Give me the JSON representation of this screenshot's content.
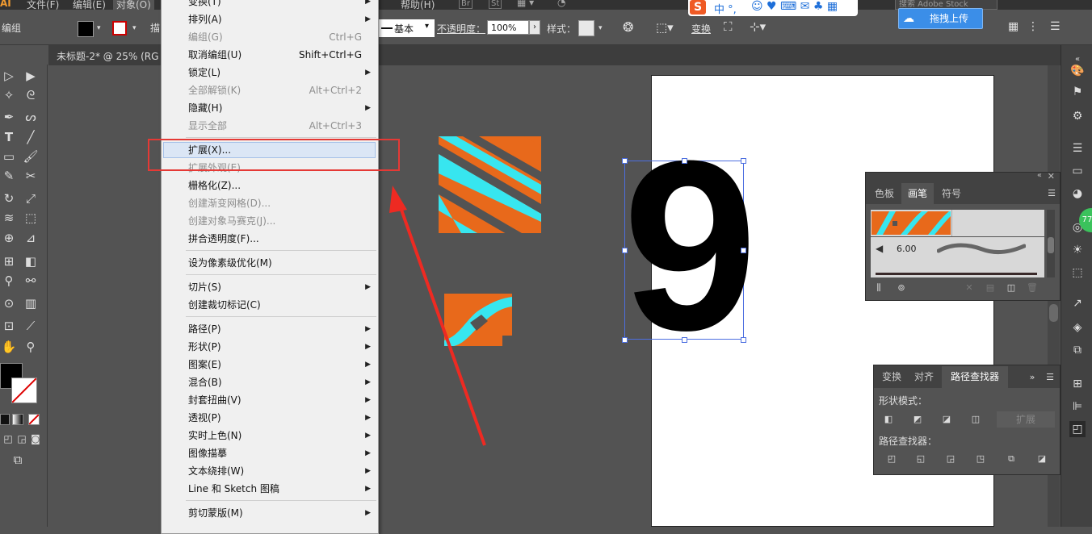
{
  "menubar": {
    "logo": "AI",
    "items": [
      "文件(F)",
      "编辑(E)",
      "对象(O)",
      "帮助(H)"
    ],
    "br": "Br",
    "st": "St",
    "search": "搜索 Adobe Stock"
  },
  "control": {
    "label_group": "编组",
    "stroke_style": "基本",
    "opacity_label": "不透明度：",
    "opacity_value": "100%",
    "style_label": "样式：",
    "transform": "变换",
    "truncated_char": "描"
  },
  "document": {
    "tab_title": "未标题-2* @ 25% (RG"
  },
  "sogou": {
    "chars": "中 °,",
    "upload_label": "拖拽上传"
  },
  "object_menu": {
    "items": [
      {
        "label": "变换(T)",
        "shortcut": "",
        "arrow": true,
        "disabled": false
      },
      {
        "label": "排列(A)",
        "shortcut": "",
        "arrow": true,
        "disabled": false
      },
      {
        "label": "编组(G)",
        "shortcut": "Ctrl+G",
        "arrow": false,
        "disabled": true
      },
      {
        "label": "取消编组(U)",
        "shortcut": "Shift+Ctrl+G",
        "arrow": false,
        "disabled": false
      },
      {
        "label": "锁定(L)",
        "shortcut": "",
        "arrow": true,
        "disabled": false
      },
      {
        "label": "全部解锁(K)",
        "shortcut": "Alt+Ctrl+2",
        "arrow": false,
        "disabled": true
      },
      {
        "label": "隐藏(H)",
        "shortcut": "",
        "arrow": true,
        "disabled": false
      },
      {
        "label": "显示全部",
        "shortcut": "Alt+Ctrl+3",
        "arrow": false,
        "disabled": true
      },
      {
        "label": "扩展(X)...",
        "shortcut": "",
        "arrow": false,
        "disabled": false,
        "highlighted": true
      },
      {
        "label": "扩展外观(E)",
        "shortcut": "",
        "arrow": false,
        "disabled": true
      },
      {
        "label": "栅格化(Z)...",
        "shortcut": "",
        "arrow": false,
        "disabled": false
      },
      {
        "label": "创建渐变网格(D)...",
        "shortcut": "",
        "arrow": false,
        "disabled": true
      },
      {
        "label": "创建对象马赛克(J)...",
        "shortcut": "",
        "arrow": false,
        "disabled": true
      },
      {
        "label": "拼合透明度(F)...",
        "shortcut": "",
        "arrow": false,
        "disabled": false
      },
      {
        "label": "设为像素级优化(M)",
        "shortcut": "",
        "arrow": false,
        "disabled": false
      },
      {
        "label": "切片(S)",
        "shortcut": "",
        "arrow": true,
        "disabled": false
      },
      {
        "label": "创建裁切标记(C)",
        "shortcut": "",
        "arrow": false,
        "disabled": false
      },
      {
        "label": "路径(P)",
        "shortcut": "",
        "arrow": true,
        "disabled": false
      },
      {
        "label": "形状(P)",
        "shortcut": "",
        "arrow": true,
        "disabled": false
      },
      {
        "label": "图案(E)",
        "shortcut": "",
        "arrow": true,
        "disabled": false
      },
      {
        "label": "混合(B)",
        "shortcut": "",
        "arrow": true,
        "disabled": false
      },
      {
        "label": "封套扭曲(V)",
        "shortcut": "",
        "arrow": true,
        "disabled": false
      },
      {
        "label": "透视(P)",
        "shortcut": "",
        "arrow": true,
        "disabled": false
      },
      {
        "label": "实时上色(N)",
        "shortcut": "",
        "arrow": true,
        "disabled": false
      },
      {
        "label": "图像描摹",
        "shortcut": "",
        "arrow": true,
        "disabled": false
      },
      {
        "label": "文本绕排(W)",
        "shortcut": "",
        "arrow": true,
        "disabled": false
      },
      {
        "label": "Line 和 Sketch 图稿",
        "shortcut": "",
        "arrow": true,
        "disabled": false
      },
      {
        "label": "剪切蒙版(M)",
        "shortcut": "",
        "arrow": true,
        "disabled": false
      }
    ]
  },
  "artwork": {
    "glyph": "9"
  },
  "brush_panel": {
    "tabs": [
      "色板",
      "画笔",
      "符号"
    ],
    "active_tab": "画笔",
    "stroke_size": "6.00"
  },
  "pathfinder_panel": {
    "tabs": [
      "变换",
      "对齐",
      "路径查找器"
    ],
    "active_tab": "路径查找器",
    "shape_modes_label": "形状模式：",
    "expand_label": "扩展",
    "pathfinders_label": "路径查找器："
  },
  "colors": {
    "orange": "#e8691b",
    "cyan": "#37e6ef",
    "highlight_box": "#e53935",
    "arrow": "#ee2a22"
  }
}
